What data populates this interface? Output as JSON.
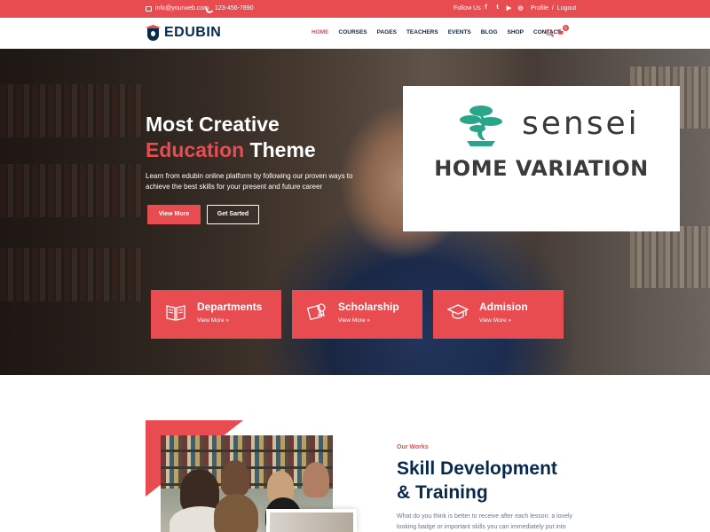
{
  "topbar": {
    "email": "info@yourweb.com",
    "phone": "123-456-7890",
    "follow_label": "Follow Us :",
    "social": [
      {
        "icon": "facebook-icon",
        "glyph": "f"
      },
      {
        "icon": "twitter-icon",
        "glyph": "t"
      },
      {
        "icon": "youtube-icon",
        "glyph": "▶"
      },
      {
        "icon": "instagram-icon",
        "glyph": "◎"
      }
    ],
    "profile": "Profile",
    "separator": "/",
    "logout": "Logout"
  },
  "nav": {
    "logo_text": "EDUBIN",
    "items": [
      "HOME",
      "COURSES",
      "PAGES",
      "TEACHERS",
      "EVENTS",
      "BLOG",
      "SHOP",
      "CONTACT"
    ],
    "active": "HOME",
    "cart_count": "0"
  },
  "hero": {
    "title_line1": "Most Creative",
    "title_accent": "Education",
    "title_rest": " Theme",
    "description": "Learn from edubin online platform by following our proven ways to achieve the best skills for your present and future career",
    "btn_primary": "View More",
    "btn_secondary": "Get Sarted"
  },
  "features": [
    {
      "title": "Departments",
      "link": "View More »",
      "icon": "book-icon"
    },
    {
      "title": "Scholarship",
      "link": "View More »",
      "icon": "certificate-icon"
    },
    {
      "title": "Admision",
      "link": "View More »",
      "icon": "graduation-cap-icon"
    }
  ],
  "overlay": {
    "brand": "sensei",
    "subtitle": "HOME VARIATION",
    "logo_icon": "bonsai-tree-icon",
    "logo_color": "#2aa58a"
  },
  "about": {
    "label": "Our Works",
    "title_line1": "Skill Development",
    "title_line2": "& Training",
    "text": "What do you think is better to receive after each lesson: a lovely looking badge or important skills you can immediately put into"
  },
  "colors": {
    "accent": "#e84b50",
    "navy": "#07294d"
  }
}
